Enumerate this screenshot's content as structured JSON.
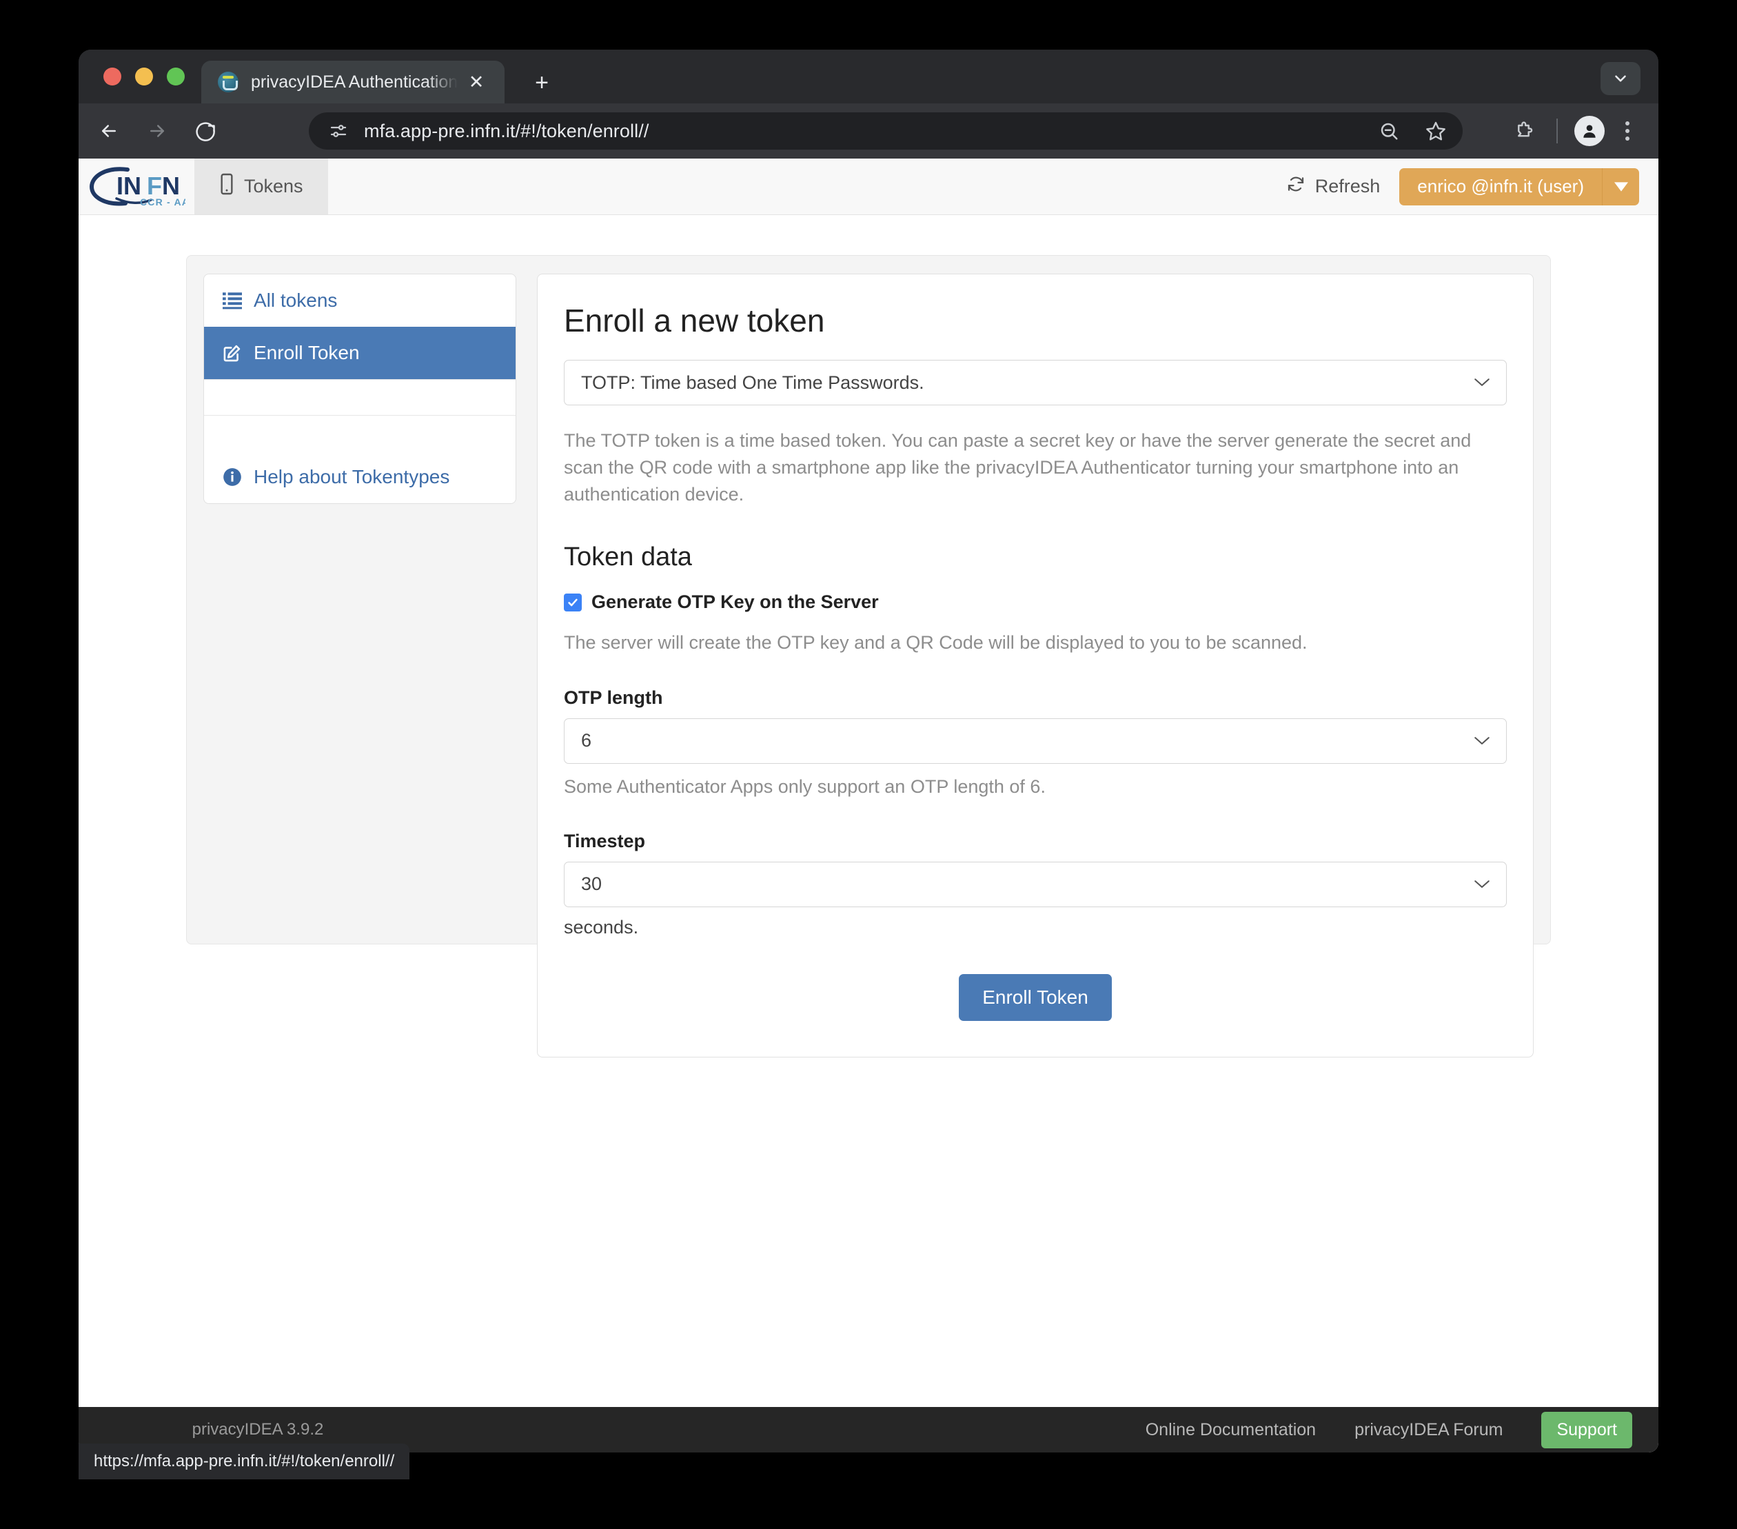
{
  "browser": {
    "tab": {
      "title": "privacyIDEA Authentication S",
      "favicon_icon": "privacyidea-favicon",
      "close_icon": "close-icon"
    },
    "new_tab_icon": "plus-icon",
    "tab_list_icon": "chevron-down-icon",
    "nav": {
      "back_icon": "back-arrow-icon",
      "forward_icon": "forward-arrow-icon",
      "reload_icon": "reload-icon"
    },
    "omnibox": {
      "site_info_icon": "site-settings-icon",
      "url": "mfa.app-pre.infn.it/#!/token/enroll//",
      "zoom_out_icon": "zoom-out-icon",
      "bookmark_icon": "star-icon"
    },
    "extensions_icon": "extensions-puzzle-icon",
    "profile_icon": "profile-avatar-icon",
    "menu_icon": "three-dot-menu-icon",
    "status_bubble": "https://mfa.app-pre.infn.it/#!/token/enroll//"
  },
  "app": {
    "logo": {
      "text_in": "IN",
      "text_f": "F",
      "text_n": "N",
      "subtitle": "CCR - AAI"
    },
    "nav_tab": {
      "label": "Tokens",
      "icon": "mobile-device-icon"
    },
    "refresh": {
      "label": "Refresh",
      "icon": "refresh-icon"
    },
    "user": {
      "label": "enrico @infn.it (user)",
      "caret_icon": "caret-down-icon"
    }
  },
  "sidebar": {
    "items": [
      {
        "label": "All tokens",
        "icon": "list-icon",
        "active": false
      },
      {
        "label": "Enroll Token",
        "icon": "edit-square-icon",
        "active": true
      },
      {
        "label": "Help about Tokentypes",
        "icon": "info-circle-icon",
        "active": false
      }
    ]
  },
  "main": {
    "title": "Enroll a new token",
    "token_type": {
      "selected": "TOTP: Time based One Time Passwords.",
      "caret_icon": "chevron-down-icon"
    },
    "type_description": "The TOTP token is a time based token. You can paste a secret key or have the server generate the secret and scan the QR code with a smartphone app like the privacyIDEA Authenticator turning your smartphone into an authentication device.",
    "token_data_title": "Token data",
    "generate_key": {
      "label": "Generate OTP Key on the Server",
      "checked": true,
      "help": "The server will create the OTP key and a QR Code will be displayed to you to be scanned."
    },
    "otp_length": {
      "label": "OTP length",
      "value": "6",
      "help": "Some Authenticator Apps only support an OTP length of 6."
    },
    "timestep": {
      "label": "Timestep",
      "value": "30",
      "help": "seconds."
    },
    "enroll_button": "Enroll Token"
  },
  "footer": {
    "version": "privacyIDEA 3.9.2",
    "links": [
      "Online Documentation",
      "privacyIDEA Forum"
    ],
    "support_button": "Support"
  },
  "colors": {
    "accent_blue": "#4a7ab5",
    "user_orange": "#e0a757",
    "support_green": "#6cb86c",
    "checkbox_blue": "#3b82f6",
    "logo_navy": "#1f3864",
    "logo_lightblue": "#5b9bc4"
  }
}
